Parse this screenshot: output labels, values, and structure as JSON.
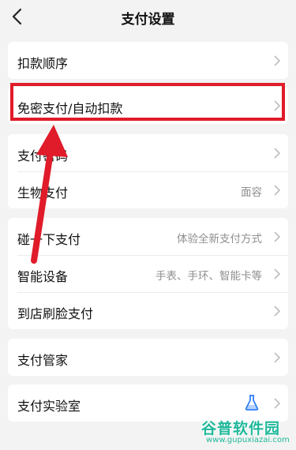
{
  "header": {
    "title": "支付设置"
  },
  "groups": [
    {
      "items": [
        {
          "label": "扣款顺序"
        }
      ]
    },
    {
      "items": [
        {
          "label": "免密支付/自动扣款"
        }
      ]
    },
    {
      "items": [
        {
          "label": "支付密码"
        },
        {
          "label": "生物支付",
          "value": "面容"
        }
      ]
    },
    {
      "items": [
        {
          "label": "碰一下支付",
          "value": "体验全新支付方式"
        },
        {
          "label": "智能设备",
          "value": "手表、手环、智能卡等"
        },
        {
          "label": "到店刷脸支付"
        }
      ]
    },
    {
      "items": [
        {
          "label": "支付管家"
        }
      ]
    },
    {
      "items": [
        {
          "label": "支付实验室",
          "icon": "flask-icon"
        }
      ]
    }
  ],
  "annotation": {
    "highlight_color": "#e01b2a"
  },
  "watermark": {
    "brand": "谷普软件园",
    "url": "www.gupuxiazai.com"
  }
}
